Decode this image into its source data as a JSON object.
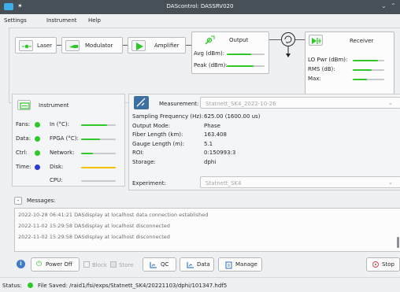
{
  "window": {
    "title": "DAScontrol: DASSRV020"
  },
  "menu": [
    "Settings",
    "Instrument",
    "Help"
  ],
  "pipeline": {
    "laser_label": "Laser",
    "modulator_label": "Modulator",
    "amplifier_label": "Amplifier",
    "output": {
      "title": "Output",
      "avg_label": "Avg (dBm):",
      "peak_label": "Peak (dBm):",
      "avg_level": 0.65,
      "peak_level": 0.7
    },
    "receiver": {
      "title": "Receiver",
      "lo_label": "LO Pwr (dBm):",
      "rms_label": "RMS (dB):",
      "max_label": "Max:",
      "lo_level": 0.8,
      "rms_level": 0.6,
      "max_level": 0.45
    }
  },
  "instrument": {
    "title": "Instrument",
    "rows": [
      {
        "left": "Fans:",
        "right": "In (°C):",
        "led": "#2ec928",
        "level": 0.75,
        "bar_color": "#2ec928"
      },
      {
        "left": "Data:",
        "right": "FPGA (°C):",
        "led": "#2ec928",
        "level": 0.55,
        "bar_color": "#2ec928"
      },
      {
        "left": "Ctrl:",
        "right": "Network:",
        "led": "#2ec928",
        "level": 0.35,
        "bar_color": "#2ec928"
      },
      {
        "left": "Time:",
        "right": "Disk:",
        "led": "#2a3bd6",
        "level": 1.0,
        "bar_color": "#f2c200"
      },
      {
        "left": "",
        "right": "CPU:",
        "led": null,
        "level": 0.0,
        "bar_color": "#2ec928"
      }
    ]
  },
  "measurement": {
    "label": "Measurement:",
    "value": "Statnett_SK4_2022-10-26",
    "rows": [
      {
        "k": "Sampling Frequency (Hz):",
        "v": "625.00 (1600.00 us)"
      },
      {
        "k": "Output Mode:",
        "v": "Phase"
      },
      {
        "k": "Fiber Length (km):",
        "v": "163.408"
      },
      {
        "k": "Gauge Length (m):",
        "v": "5.1"
      },
      {
        "k": "ROI:",
        "v": "0:150993:3"
      },
      {
        "k": "Storage:",
        "v": "dphi"
      }
    ],
    "experiment_label": "Experiment:",
    "experiment_value": "Statnett_SK4"
  },
  "messages": {
    "title": "Messages:",
    "collapse_glyph": "-",
    "lines": [
      "2022-10-28 06:41:21 DASdisplay at localhost data connection established",
      "2022-11-02 15:29:58 DASdisplay at localhost disconnected",
      "2022-11-02 15:29:58 DASdisplay at localhost disconnected"
    ]
  },
  "toolbar": {
    "info_glyph": "i",
    "power_off": "Power Off",
    "block": "Block",
    "store": "Store",
    "qc": "QC",
    "data": "Data",
    "manage": "Manage",
    "stop": "Stop"
  },
  "status": {
    "label": "Status:",
    "led": "#2ec928",
    "text": "File Saved: /raid1/fsi/exps/Statnett_SK4/20221103/dphi/101347.hdf5"
  }
}
